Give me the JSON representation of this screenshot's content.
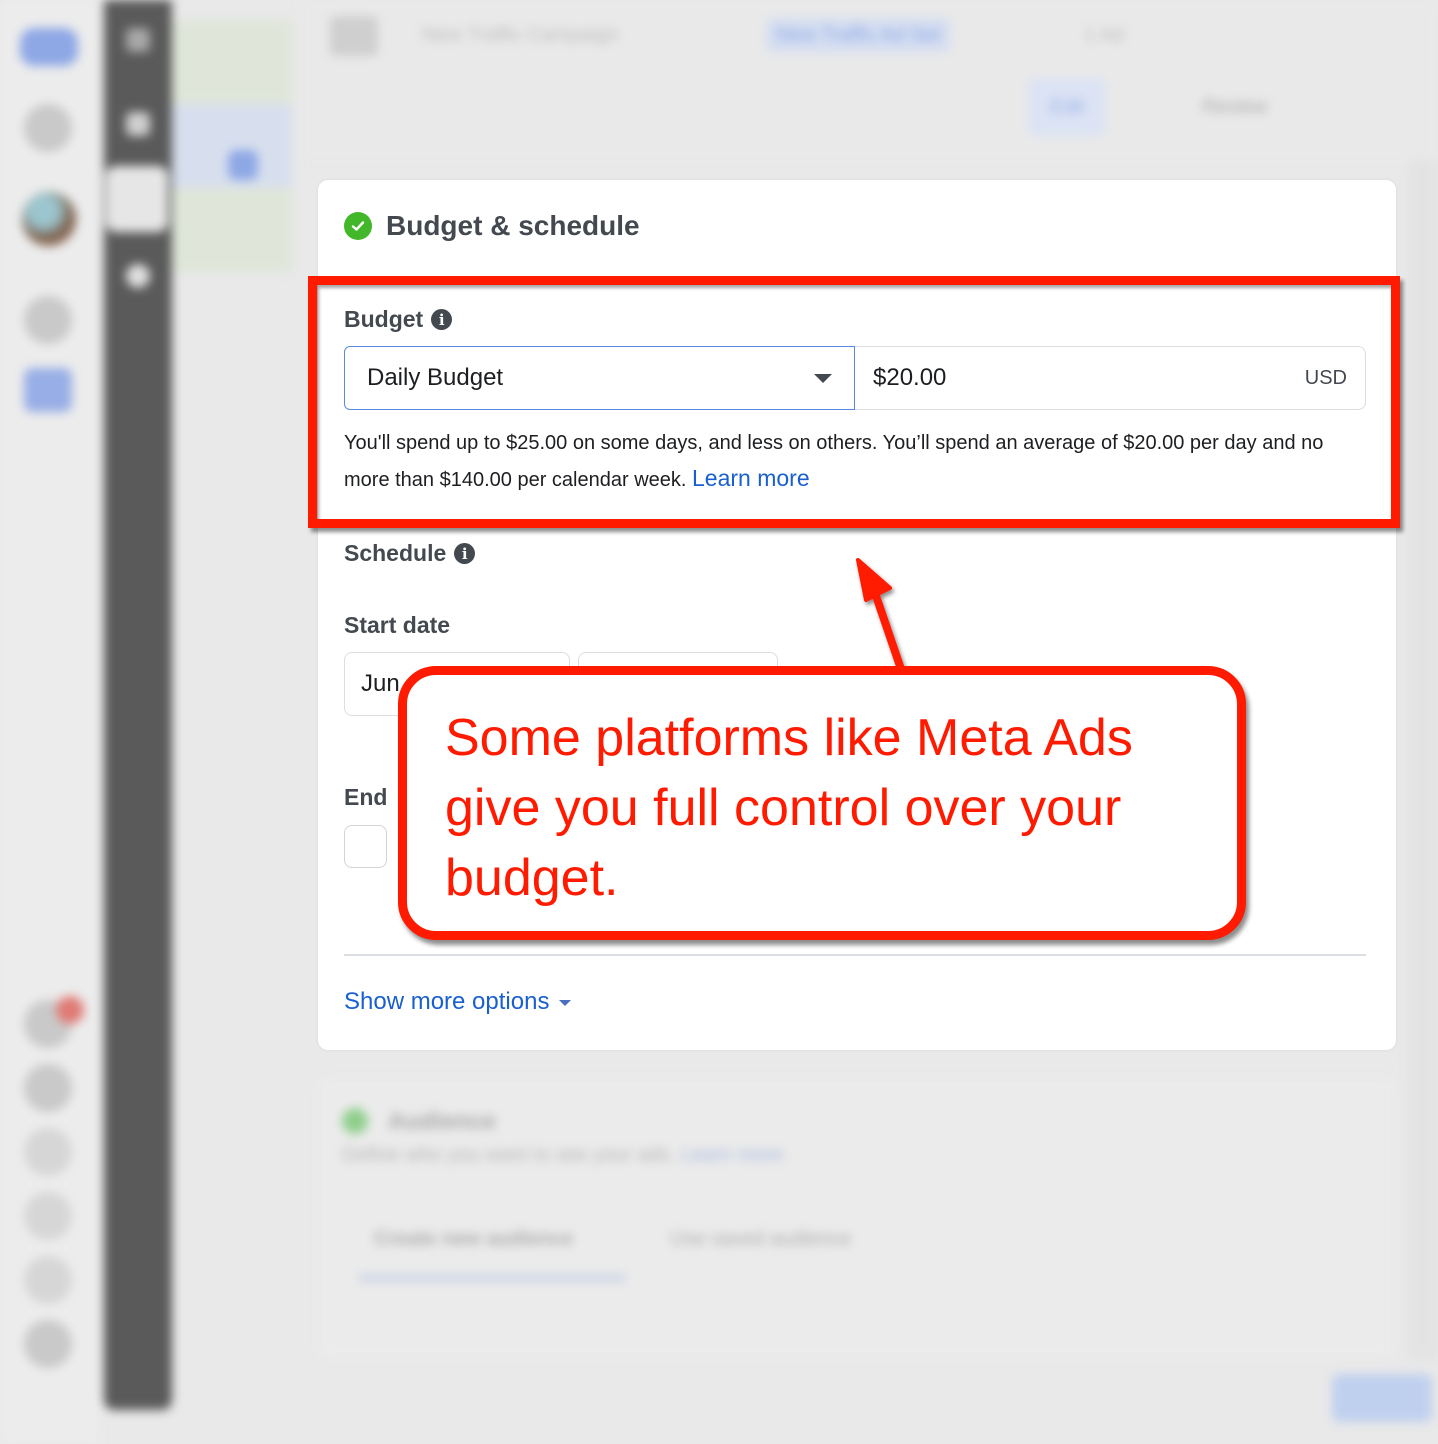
{
  "background": {
    "breadcrumbs": [
      "New Traffic Campaign",
      "New Traffic Ad Set",
      "1 Ad"
    ],
    "active_breadcrumb_index": 1,
    "top_actions": {
      "edit_label": "Edit",
      "review_label": "Review"
    },
    "nav_icons": [
      "meta-logo",
      "home-icon",
      "profile-avatar",
      "help-icon",
      "ads-manager-icon",
      "notifications-icon",
      "settings-icon",
      "alerts-icon",
      "search-icon",
      "help-icon",
      "grid-icon"
    ],
    "tool_rail_icons": [
      "close-icon",
      "chart-icon",
      "edit-icon",
      "clock-icon"
    ],
    "audience_section": {
      "title": "Audience",
      "description": "Define who you want to see your ads.",
      "learn_more": "Learn more",
      "tabs": [
        "Create new audience",
        "Use saved audience"
      ],
      "active_tab_index": 0
    }
  },
  "card": {
    "title": "Budget & schedule",
    "status": "complete",
    "budget": {
      "label": "Budget",
      "type_options_selected": "Daily Budget",
      "amount": "$20.00",
      "currency": "USD",
      "help_text": "You'll spend up to $25.00 on some days, and less on others. You’ll spend an average of $20.00 per day and no more than $140.00 per calendar week.",
      "learn_more": "Learn more"
    },
    "schedule": {
      "label": "Schedule",
      "start_date_label": "Start date",
      "start_date_value": "Jun",
      "end_label": "End"
    },
    "show_more_options": "Show more options"
  },
  "annotation": {
    "callout_text": "Some platforms like Meta Ads give you full control over your budget.",
    "color": "#ff1a00"
  },
  "colors": {
    "accent_blue": "#1a5fd0",
    "success_green": "#42b72a",
    "annotation_red": "#ff1a00"
  }
}
